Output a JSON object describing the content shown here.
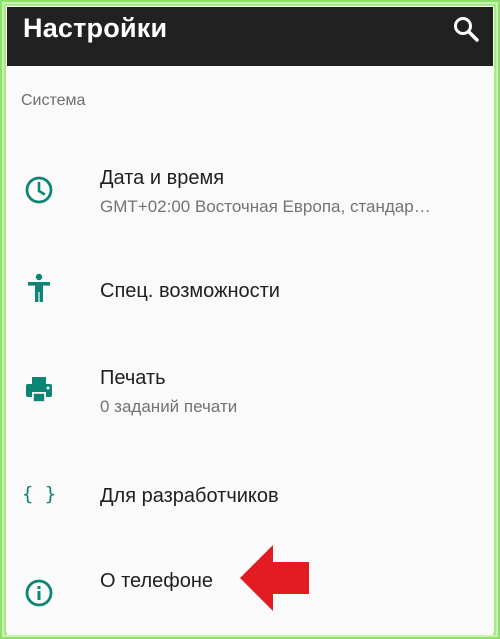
{
  "appbar": {
    "title": "Настройки",
    "search_icon": "search-icon"
  },
  "section": {
    "header": "Система"
  },
  "items": [
    {
      "icon": "clock-icon",
      "title": "Дата и время",
      "subtitle": "GMT+02:00 Восточная Европа, стандар…"
    },
    {
      "icon": "accessibility-icon",
      "title": "Спец. возможности"
    },
    {
      "icon": "printer-icon",
      "title": "Печать",
      "subtitle": "0 заданий печати"
    },
    {
      "icon": "braces-icon",
      "title": "Для разработчиков",
      "glyph": "{ }"
    },
    {
      "icon": "info-icon",
      "title": "О телефоне"
    }
  ],
  "colors": {
    "accent": "#0d8574",
    "appbar": "#212121",
    "arrow": "#e31b23",
    "frame": "#8fe06a"
  }
}
